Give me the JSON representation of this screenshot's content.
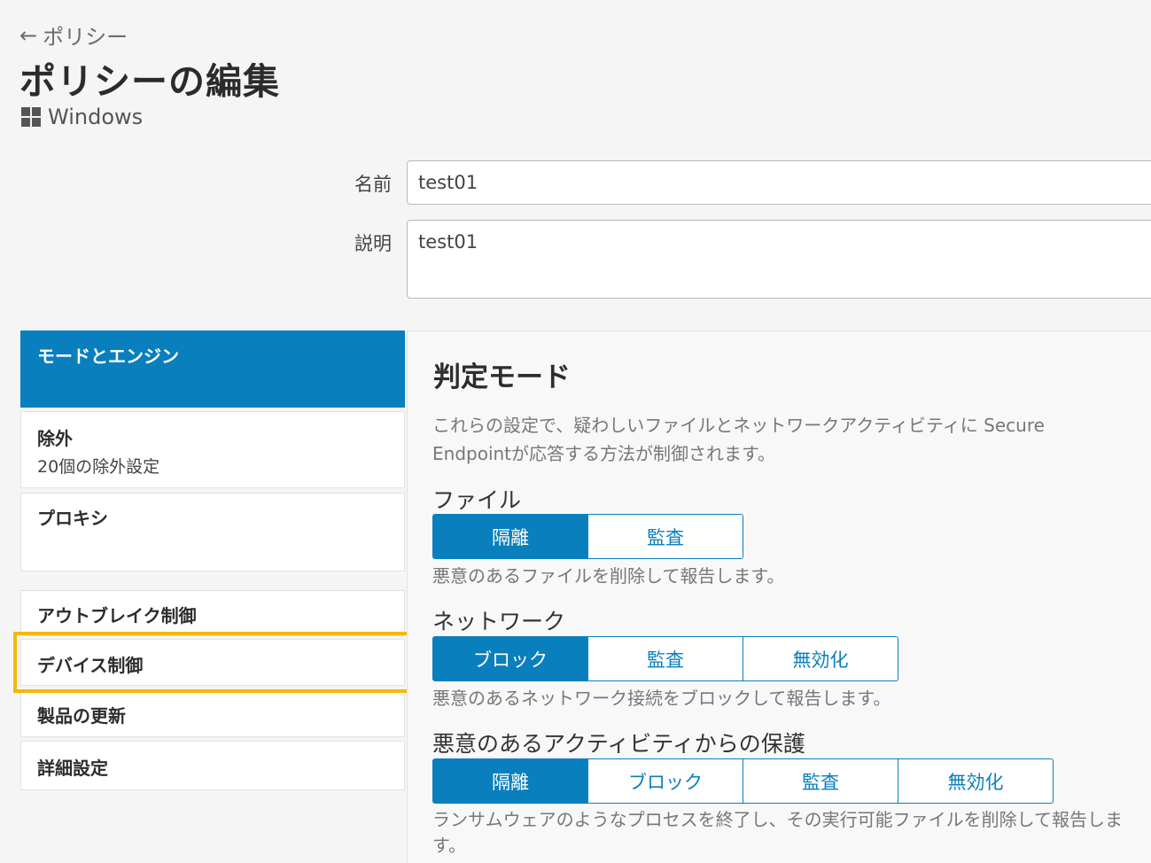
{
  "header": {
    "back_label": "ポリシー",
    "page_title": "ポリシーの編集",
    "os_name": "Windows"
  },
  "form": {
    "name_label": "名前",
    "name_value": "test01",
    "description_label": "説明",
    "description_value": "test01"
  },
  "sidebar": {
    "items": [
      {
        "title": "モードとエンジン",
        "subtitle": ""
      },
      {
        "title": "除外",
        "subtitle": "20個の除外設定"
      },
      {
        "title": "プロキシ",
        "subtitle": ""
      },
      {
        "title": "アウトブレイク制御",
        "subtitle": ""
      },
      {
        "title": "デバイス制御",
        "subtitle": ""
      },
      {
        "title": "製品の更新",
        "subtitle": ""
      },
      {
        "title": "詳細設定",
        "subtitle": ""
      }
    ],
    "active_index": 0,
    "highlighted_index": 4
  },
  "main": {
    "section_title": "判定モード",
    "section_description": "これらの設定で、疑わしいファイルとネットワークアクティビティに Secure Endpointが応答する方法が制御されます。",
    "file": {
      "label": "ファイル",
      "options": [
        "隔離",
        "監査"
      ],
      "selected": "隔離",
      "help": "悪意のあるファイルを削除して報告します。"
    },
    "network": {
      "label": "ネットワーク",
      "options": [
        "ブロック",
        "監査",
        "無効化"
      ],
      "selected": "ブロック",
      "help": "悪意のあるネットワーク接続をブロックして報告します。"
    },
    "activity": {
      "label": "悪意のあるアクティビティからの保護",
      "options": [
        "隔離",
        "ブロック",
        "監査",
        "無効化"
      ],
      "selected": "隔離",
      "help": "ランサムウェアのようなプロセスを終了し、その実行可能ファイルを削除して報告します。"
    }
  },
  "colors": {
    "accent": "#0a7fbd",
    "highlight": "#f5b800",
    "background": "#f5f5f5"
  }
}
